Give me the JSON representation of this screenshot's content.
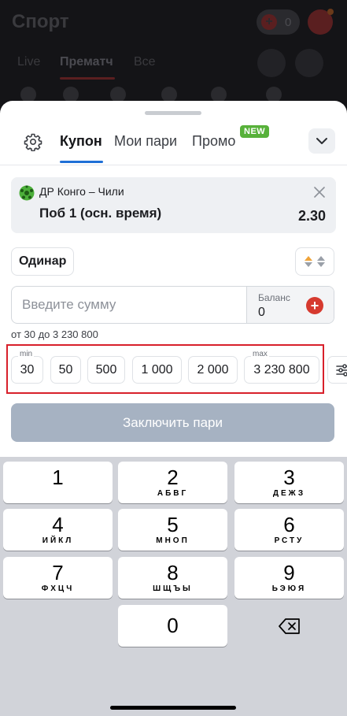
{
  "background": {
    "title": "Спорт",
    "wallet_count": "0",
    "tabs": [
      "Live",
      "Прематч",
      "Все"
    ]
  },
  "sheet": {
    "tabs": [
      {
        "label": "Купон",
        "active": true
      },
      {
        "label": "Мои пари",
        "active": false
      },
      {
        "label": "Промо",
        "active": false
      }
    ],
    "promo_badge": "NEW"
  },
  "bet": {
    "match": "ДР Конго – Чили",
    "outcome": "Поб 1 (осн. время)",
    "odds": "2.30"
  },
  "bet_type": "Одинар",
  "amount": {
    "placeholder": "Введите сумму",
    "value": "",
    "balance_label": "Баланс",
    "balance_value": "0",
    "range_text": "от 30 до 3 230 800"
  },
  "quick_amounts": [
    {
      "value": "30",
      "caption": "min"
    },
    {
      "value": "50",
      "caption": ""
    },
    {
      "value": "500",
      "caption": ""
    },
    {
      "value": "1 000",
      "caption": ""
    },
    {
      "value": "2 000",
      "caption": ""
    },
    {
      "value": "3 230 800",
      "caption": "max"
    }
  ],
  "place_button": "Заключить пари",
  "keyboard": {
    "keys": [
      {
        "digit": "1",
        "letters": ""
      },
      {
        "digit": "2",
        "letters": "АБВГ"
      },
      {
        "digit": "3",
        "letters": "ДЕЖЗ"
      },
      {
        "digit": "4",
        "letters": "ИЙКЛ"
      },
      {
        "digit": "5",
        "letters": "МНОП"
      },
      {
        "digit": "6",
        "letters": "РСТУ"
      },
      {
        "digit": "7",
        "letters": "ФХЦЧ"
      },
      {
        "digit": "8",
        "letters": "ШЩЪЫ"
      },
      {
        "digit": "9",
        "letters": "ЬЭЮЯ"
      },
      {
        "digit": "0",
        "letters": ""
      }
    ]
  },
  "colors": {
    "accent_blue": "#1f6fd6",
    "danger_red": "#d63a2f",
    "highlight_frame": "#d8202b",
    "new_badge": "#57b13a",
    "disabled_button": "#a6b2c2"
  }
}
